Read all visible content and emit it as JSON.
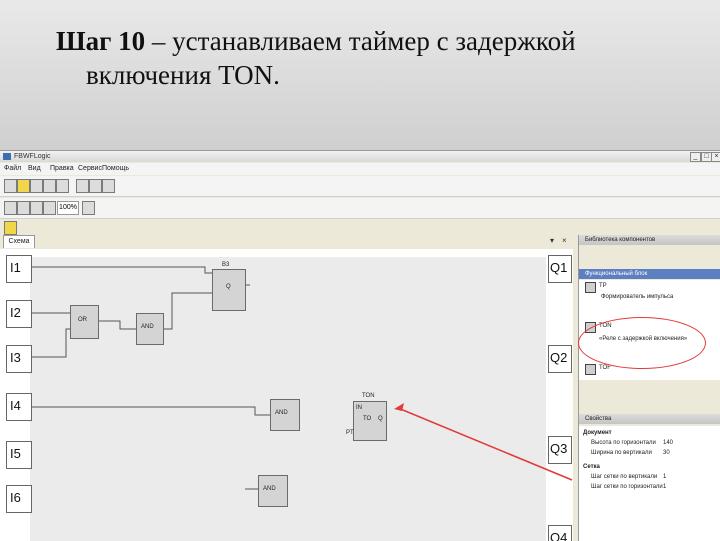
{
  "slide": {
    "title_bold": "Шаг 10",
    "title_rest": " – устанавливаем таймер с задержкой",
    "title_line2": "включения TON."
  },
  "window": {
    "app_title": "FBWFLogic",
    "controls": [
      "_",
      "□",
      "×"
    ]
  },
  "menu": [
    "Файл",
    "Вид",
    "Правка",
    "Сервис",
    "Помощь"
  ],
  "toolbar": {
    "zoom": "100%"
  },
  "document": {
    "tab": "Схема"
  },
  "inputs": [
    "I1",
    "I2",
    "I3",
    "I4",
    "I5",
    "I6"
  ],
  "outputs": [
    "Q1",
    "Q2",
    "Q3",
    "Q4"
  ],
  "blocks": {
    "b1_title": "B3",
    "b1_text": "Q",
    "b2_text": "OR",
    "b3_text": "AND",
    "b4_text": "AND",
    "b5_text": "AND",
    "ton_title": "TON",
    "ton_text": "TO",
    "ton_in": "IN",
    "ton_pt": "PT",
    "ton_out": "Q"
  },
  "side_panel": {
    "header1": "Библиотека компонентов",
    "header2": "Функциональный блок",
    "items": [
      "TP",
      "Формирователь импульса",
      "TON",
      "«Реле с задержкой включения»",
      "TOF"
    ],
    "properties_header": "Свойства",
    "prop_group1": "Документ",
    "prop_rows1": [
      [
        "Высота по горизонтали",
        "140"
      ],
      [
        "Ширина по вертикали",
        "30"
      ]
    ],
    "prop_group2": "Сетка",
    "prop_rows2": [
      [
        "Шаг сетки по вертикали",
        "1"
      ],
      [
        "Шаг сетки по горизонтали",
        "1"
      ]
    ]
  },
  "colors": {
    "annotation": "#e23a3a",
    "workarea": "#ebebeb",
    "block": "#d4d4d4"
  }
}
